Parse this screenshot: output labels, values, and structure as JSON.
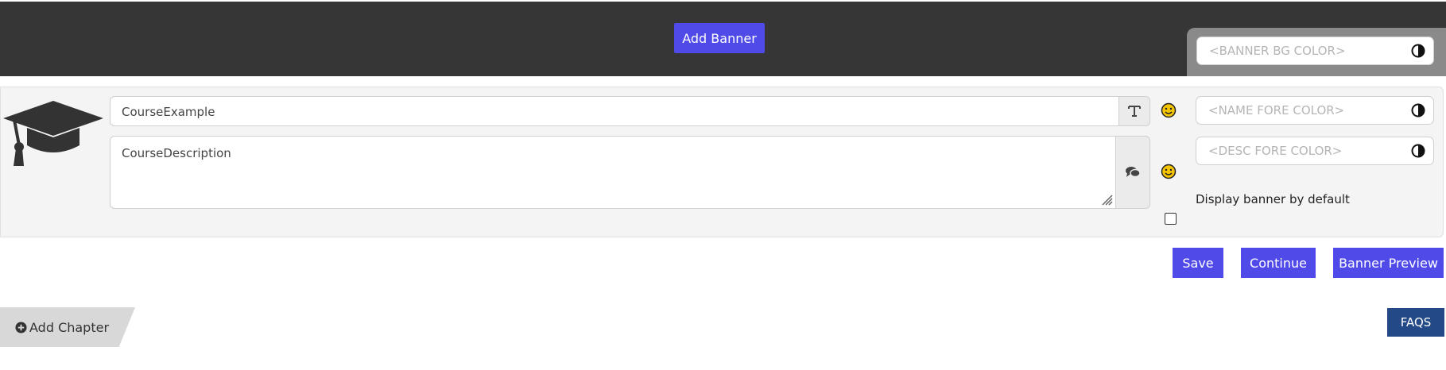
{
  "header": {
    "add_banner_label": "Add Banner"
  },
  "banner": {
    "bg_color_placeholder": "<BANNER BG COLOR>",
    "name_value": "CourseExample",
    "description_value": "CourseDescription",
    "name_fore_color_placeholder": "<NAME FORE COLOR>",
    "desc_fore_color_placeholder": "<DESC FORE COLOR>",
    "display_by_default_label": "Display banner by default",
    "display_by_default_checked": false
  },
  "actions": {
    "save_label": "Save",
    "continue_label": "Continue",
    "preview_label": "Banner Preview"
  },
  "footer": {
    "add_chapter_label": "Add Chapter",
    "faqs_label": "FAQS"
  },
  "colors": {
    "header_bg": "#363636",
    "primary": "#4f4ae8",
    "faqs_bg": "#234a86",
    "emoji_yellow": "#f5c400"
  },
  "icons": [
    "graduation-cap-icon",
    "text-format-icon",
    "chat-icon",
    "smiley-icon",
    "contrast-icon",
    "plus-circle-icon"
  ]
}
